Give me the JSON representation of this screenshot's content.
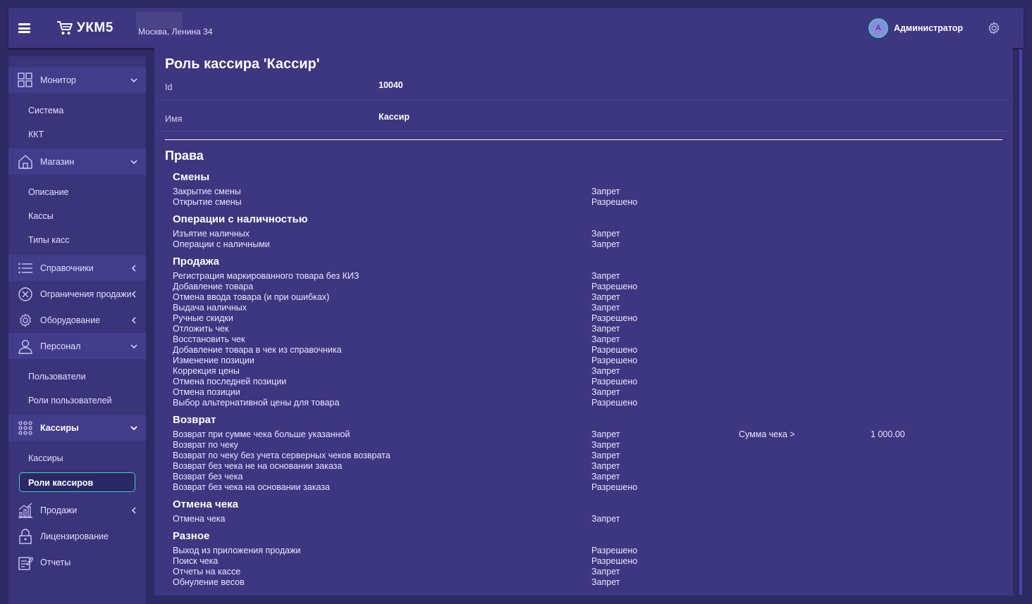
{
  "header": {
    "logo_text": "УКМ5",
    "store_address": "Москва, Ленина 34",
    "avatar_letter": "А",
    "user_name": "Администратор"
  },
  "sidebar": {
    "monitor": {
      "label": "Монитор",
      "items": [
        "Система",
        "ККТ"
      ]
    },
    "shop": {
      "label": "Магазин",
      "items": [
        "Описание",
        "Кассы",
        "Типы касс"
      ]
    },
    "references": "Справочники",
    "sale_limits": "Ограничения продажи",
    "equipment": "Оборудование",
    "staff": {
      "label": "Персонал",
      "items": [
        "Пользователи",
        "Роли пользователей"
      ]
    },
    "cashiers": {
      "label": "Кассиры",
      "items": [
        "Кассиры",
        "Роли кассиров"
      ]
    },
    "sales": "Продажи",
    "licensing": "Лицензирование",
    "reports": "Отчеты"
  },
  "main": {
    "title": "Роль кассира 'Кассир'",
    "fields": [
      {
        "label": "Id",
        "value": "10040"
      },
      {
        "label": "Имя",
        "value": "Кассир"
      }
    ],
    "rights_title": "Права",
    "groups": [
      {
        "title": "Смены",
        "rows": [
          {
            "name": "Закрытие смены",
            "value": "Запрет"
          },
          {
            "name": "Открытие смены",
            "value": "Разрешено"
          }
        ]
      },
      {
        "title": "Операции с наличностью",
        "rows": [
          {
            "name": "Изъятие наличных",
            "value": "Запрет"
          },
          {
            "name": "Операции с наличными",
            "value": "Запрет"
          }
        ]
      },
      {
        "title": "Продажа",
        "rows": [
          {
            "name": "Регистрация маркированного товара без КИЗ",
            "value": "Запрет"
          },
          {
            "name": "Добавление товара",
            "value": "Разрешено"
          },
          {
            "name": "Отмена ввода товара (и при ошибках)",
            "value": "Запрет"
          },
          {
            "name": "Выдача наличных",
            "value": "Запрет"
          },
          {
            "name": "Ручные скидки",
            "value": "Разрешено"
          },
          {
            "name": "Отложить чек",
            "value": "Запрет"
          },
          {
            "name": "Восстановить чек",
            "value": "Запрет"
          },
          {
            "name": "Добавление товара в чек из справочника",
            "value": "Разрешено"
          },
          {
            "name": "Изменение позиции",
            "value": "Разрешено"
          },
          {
            "name": "Коррекция цены",
            "value": "Запрет"
          },
          {
            "name": "Отмена последней позиции",
            "value": "Разрешено"
          },
          {
            "name": "Отмена позиции",
            "value": "Запрет"
          },
          {
            "name": "Выбор альтернативной цены для товара",
            "value": "Разрешено"
          }
        ]
      },
      {
        "title": "Возврат",
        "rows": [
          {
            "name": "Возврат при сумме чека больше указанной",
            "value": "Запрет",
            "extra_label": "Сумма чека >",
            "extra_value": "1 000.00"
          },
          {
            "name": "Возврат по чеку",
            "value": "Запрет"
          },
          {
            "name": "Возврат по чеку без учета серверных чеков возврата",
            "value": "Запрет"
          },
          {
            "name": "Возврат без чека не на основании заказа",
            "value": "Запрет"
          },
          {
            "name": "Возврат без чека",
            "value": "Запрет"
          },
          {
            "name": "Возврат без чека на основании заказа",
            "value": "Разрешено"
          }
        ]
      },
      {
        "title": "Отмена чека",
        "rows": [
          {
            "name": "Отмена чека",
            "value": "Запрет"
          }
        ]
      },
      {
        "title": "Разное",
        "rows": [
          {
            "name": "Выход из приложения продажи",
            "value": "Разрешено"
          },
          {
            "name": "Поиск чека",
            "value": "Разрешено"
          },
          {
            "name": "Отчеты на кассе",
            "value": "Запрет"
          },
          {
            "name": "Обнуление весов",
            "value": "Запрет"
          }
        ]
      }
    ]
  }
}
